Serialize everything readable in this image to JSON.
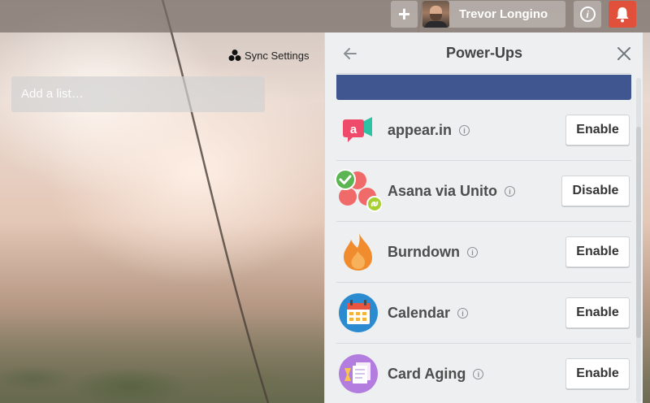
{
  "header": {
    "add_glyph": "+",
    "user_name": "Trevor Longino",
    "info_glyph": "i",
    "bell_color": "#e0503a"
  },
  "board": {
    "sync_settings_label": "Sync Settings",
    "add_list_placeholder": "Add a list…"
  },
  "panel": {
    "title": "Power-Ups",
    "banner_color": "#3f5691",
    "items": [
      {
        "name": "appear.in",
        "button": "Enable",
        "icon": "appear-in-icon"
      },
      {
        "name": "Asana via Unito",
        "button": "Disable",
        "icon": "asana-unito-icon"
      },
      {
        "name": "Burndown",
        "button": "Enable",
        "icon": "burndown-flame-icon"
      },
      {
        "name": "Calendar",
        "button": "Enable",
        "icon": "calendar-icon"
      },
      {
        "name": "Card Aging",
        "button": "Enable",
        "icon": "card-aging-icon"
      }
    ]
  }
}
